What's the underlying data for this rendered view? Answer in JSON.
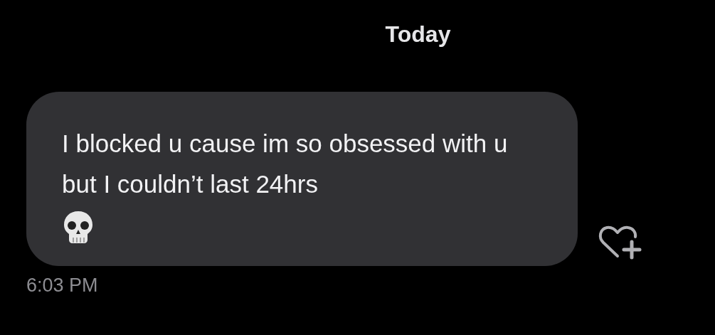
{
  "date_header": "Today",
  "message": {
    "text": "I blocked u cause im so obsessed with u but I couldn’t last 24hrs",
    "time": "6:03 PM"
  }
}
